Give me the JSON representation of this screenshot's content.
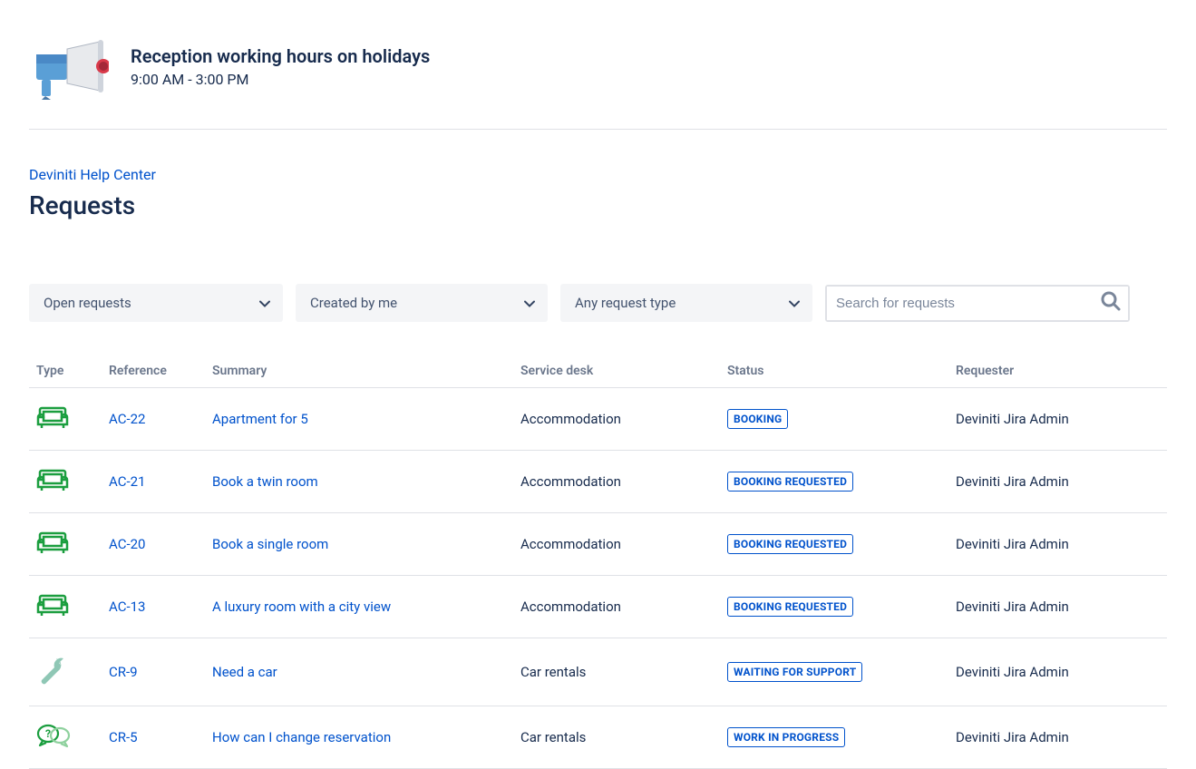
{
  "announcement": {
    "title": "Reception working hours on holidays",
    "subtitle": "9:00 AM - 3:00 PM"
  },
  "breadcrumb": {
    "text": "Deviniti Help Center"
  },
  "page": {
    "title": "Requests"
  },
  "filters": {
    "status": "Open requests",
    "creator": "Created by me",
    "requestType": "Any request type"
  },
  "search": {
    "placeholder": "Search for requests"
  },
  "table": {
    "headers": {
      "type": "Type",
      "reference": "Reference",
      "summary": "Summary",
      "serviceDesk": "Service desk",
      "status": "Status",
      "requester": "Requester"
    },
    "rows": [
      {
        "icon": "sofa",
        "reference": "AC-22",
        "summary": "Apartment for 5",
        "serviceDesk": "Accommodation",
        "status": "BOOKING",
        "requester": "Deviniti Jira Admin"
      },
      {
        "icon": "sofa",
        "reference": "AC-21",
        "summary": "Book a twin room",
        "serviceDesk": "Accommodation",
        "status": "BOOKING REQUESTED",
        "requester": "Deviniti Jira Admin"
      },
      {
        "icon": "sofa",
        "reference": "AC-20",
        "summary": "Book a single room",
        "serviceDesk": "Accommodation",
        "status": "BOOKING REQUESTED",
        "requester": "Deviniti Jira Admin"
      },
      {
        "icon": "sofa",
        "reference": "AC-13",
        "summary": "A luxury room with a city view",
        "serviceDesk": "Accommodation",
        "status": "BOOKING REQUESTED",
        "requester": "Deviniti Jira Admin"
      },
      {
        "icon": "wrench",
        "reference": "CR-9",
        "summary": "Need a car",
        "serviceDesk": "Car rentals",
        "status": "WAITING FOR SUPPORT",
        "requester": "Deviniti Jira Admin"
      },
      {
        "icon": "question",
        "reference": "CR-5",
        "summary": "How can I change reservation",
        "serviceDesk": "Car rentals",
        "status": "WORK IN PROGRESS",
        "requester": "Deviniti Jira Admin"
      }
    ]
  }
}
